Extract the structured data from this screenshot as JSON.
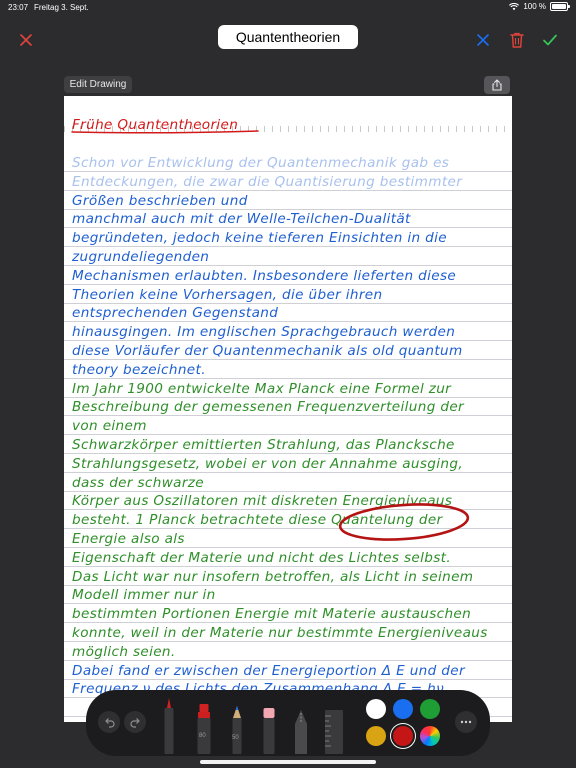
{
  "status_bar": {
    "time": "23:07",
    "date": "Freitag 3. Sept.",
    "battery": "100 %"
  },
  "header": {
    "title": "Quantentheorien"
  },
  "edit_drawing_label": "Edit Drawing",
  "note": {
    "heading": "Frühe Quantentheorien",
    "lines": [
      {
        "text": "Schon vor Entwicklung der Quantenmechanik gab es",
        "color": "faded"
      },
      {
        "text": "Entdeckungen, die zwar die Quantisierung bestimmter",
        "color": "faded"
      },
      {
        "text": "Größen beschrieben und",
        "color": "blue"
      },
      {
        "text": "manchmal auch mit der Welle-Teilchen-Dualität",
        "color": "blue"
      },
      {
        "text": "begründeten, jedoch keine tieferen Einsichten in die",
        "color": "blue"
      },
      {
        "text": "zugrundeliegenden",
        "color": "blue"
      },
      {
        "text": "Mechanismen erlaubten. Insbesondere lieferten diese",
        "color": "blue"
      },
      {
        "text": "Theorien keine Vorhersagen, die über ihren",
        "color": "blue"
      },
      {
        "text": "entsprechenden Gegenstand",
        "color": "blue"
      },
      {
        "text": "hinausgingen. Im englischen Sprachgebrauch werden",
        "color": "blue"
      },
      {
        "text": "diese Vorläufer der Quantenmechanik als old quantum",
        "color": "blue"
      },
      {
        "text": "theory bezeichnet.",
        "color": "blue"
      },
      {
        "text": "Im Jahr 1900 entwickelte Max Planck eine Formel zur",
        "color": "green"
      },
      {
        "text": "Beschreibung der gemessenen Frequenzverteilung der",
        "color": "green"
      },
      {
        "text": "von einem",
        "color": "green"
      },
      {
        "text": "Schwarzkörper emittierten Strahlung, das Plancksche",
        "color": "green"
      },
      {
        "text": "Strahlungsgesetz, wobei er von der Annahme ausging,",
        "color": "green"
      },
      {
        "text": "dass der schwarze",
        "color": "green"
      },
      {
        "text": "Körper aus Oszillatoren mit diskreten Energieniveaus",
        "color": "green"
      },
      {
        "text": "besteht. 1 Planck betrachtete diese Quantelung der",
        "color": "green"
      },
      {
        "text": "Energie also als",
        "color": "green"
      },
      {
        "text": "Eigenschaft der Materie und nicht des Lichtes selbst.",
        "color": "green"
      },
      {
        "text": "Das Licht war nur insofern betroffen, als Licht in seinem",
        "color": "green"
      },
      {
        "text": "Modell immer nur in",
        "color": "green"
      },
      {
        "text": "bestimmten Portionen Energie mit Materie austauschen",
        "color": "green"
      },
      {
        "text": "konnte, weil in der Materie nur bestimmte Energieniveaus",
        "color": "green"
      },
      {
        "text": "möglich seien.",
        "color": "green"
      },
      {
        "text": "Dabei fand er zwischen der Energieportion Δ E und der",
        "color": "blue"
      },
      {
        "text": "Frequenz ν des Lichts den Zusammenhang Δ E = hν",
        "color": "blue"
      }
    ]
  },
  "toolbar": {
    "undo_icon": "undo-icon",
    "redo_icon": "redo-icon",
    "tools": [
      "pen",
      "marker",
      "pencil",
      "eraser",
      "lasso",
      "ruler"
    ],
    "marker_label": "80",
    "pencil_label": "50",
    "colors": [
      "#ffffff",
      "#1a6ff0",
      "#1f9e35",
      "#d8a413",
      "#c41616",
      "color-wheel"
    ],
    "selected_color": "#c41616",
    "more_icon": "more-icon"
  },
  "theme": {
    "accent_blue": "#1a6ff0",
    "accent_red": "#e0443a",
    "accent_green": "#35c759"
  }
}
